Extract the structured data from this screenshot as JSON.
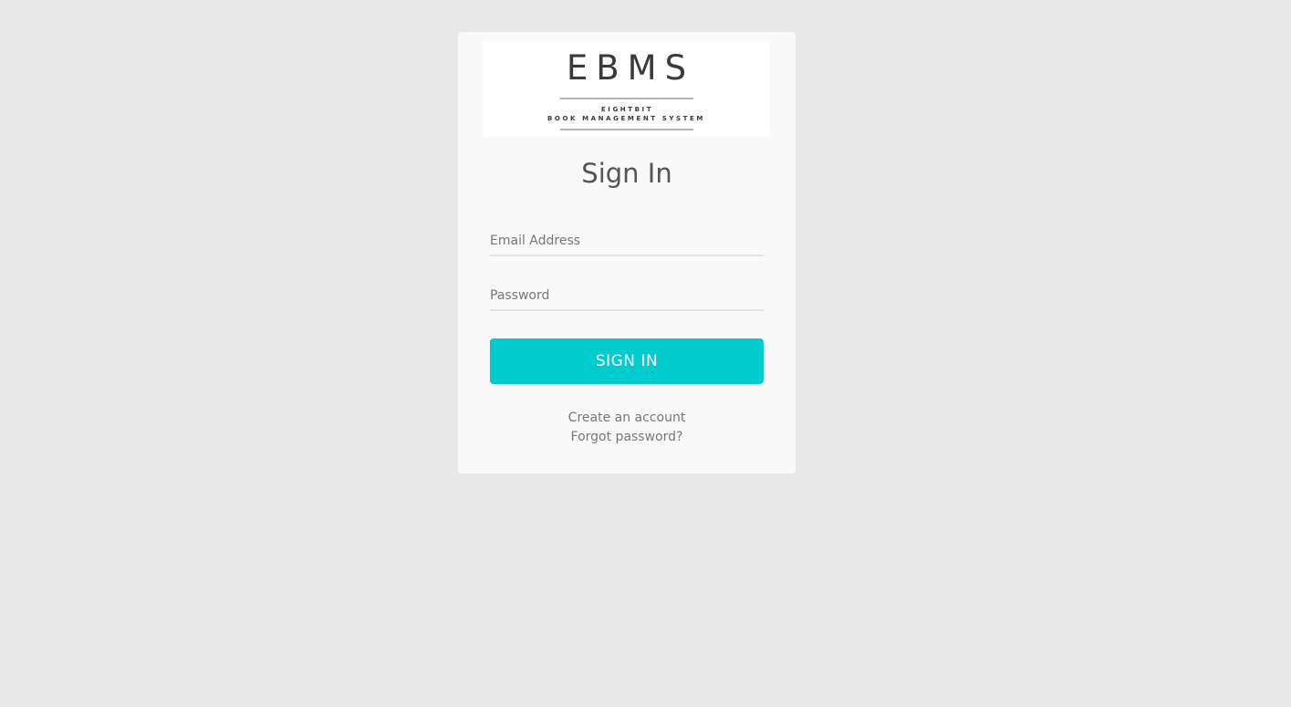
{
  "logo": {
    "mark": "EBMS",
    "line1": "EIGHTBIT",
    "line2": "BOOK MANAGEMENT SYSTEM"
  },
  "form": {
    "title": "Sign In",
    "email_placeholder": "Email Address",
    "email_value": "",
    "password_placeholder": "Password",
    "password_value": "",
    "submit_label": "SIGN IN"
  },
  "links": {
    "create_account": "Create an account",
    "forgot_password": "Forgot password?"
  },
  "colors": {
    "background": "#e8e8e8",
    "card": "#f9f9f9",
    "accent": "#00ccce",
    "title_text": "#555555",
    "link_text": "#777777"
  }
}
